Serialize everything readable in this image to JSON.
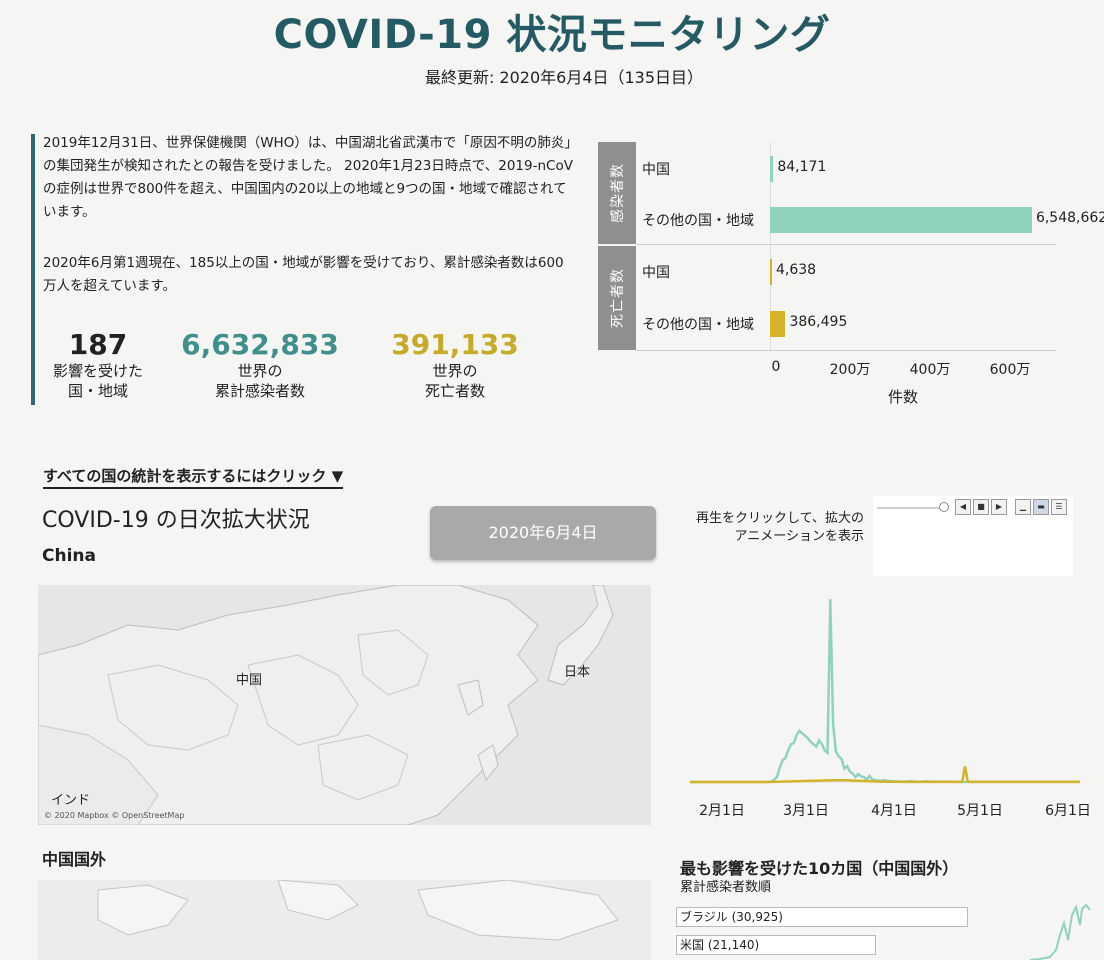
{
  "header": {
    "title": "COVID-19 状況モニタリング",
    "updated": "最終更新: 2020年6月4日（135日目）"
  },
  "intro": {
    "p1": "2019年12月31日、世界保健機関（WHO）は、中国湖北省武漢市で「原因不明の肺炎」の集団発生が検知されたとの報告を受けました。 2020年1月23日時点で、2019-nCoVの症例は世界で800件を超え、中国国内の20以上の地域と9つの国・地域で確認されています。",
    "p2": "2020年6月第1週現在、185以上の国・地域が影響を受けており、累計感染者数は600万人を超えています。"
  },
  "kpis": [
    {
      "value": "187",
      "label1": "影響を受けた",
      "label2": "国・地域",
      "color": "#222222"
    },
    {
      "value": "6,632,833",
      "label1": "世界の",
      "label2": "累計感染者数",
      "color": "#3f8f8c"
    },
    {
      "value": "391,133",
      "label1": "世界の",
      "label2": "死亡者数",
      "color": "#c7aa27"
    }
  ],
  "chart_data": [
    {
      "type": "bar",
      "orientation": "horizontal",
      "groups": [
        {
          "name": "感染者数",
          "color": "#8fd3bf",
          "rows": [
            {
              "label": "中国",
              "value": 84171,
              "value_label": "84,171"
            },
            {
              "label": "その他の国・地域",
              "value": 6548662,
              "value_label": "6,548,662"
            }
          ]
        },
        {
          "name": "死亡者数",
          "color": "#d4b32a",
          "rows": [
            {
              "label": "中国",
              "value": 4638,
              "value_label": "4,638"
            },
            {
              "label": "その他の国・地域",
              "value": 386495,
              "value_label": "386,495"
            }
          ]
        }
      ],
      "xlim": [
        0,
        7000000
      ],
      "xticks": [
        0,
        2000000,
        4000000,
        6000000
      ],
      "xtick_labels": [
        "0",
        "200万",
        "400万",
        "600万"
      ],
      "xlabel": "件数"
    },
    {
      "type": "line",
      "x_ticks": [
        "2月1日",
        "3月1日",
        "4月1日",
        "5月1日",
        "6月1日"
      ],
      "series": [
        {
          "color": "#8fd3bf",
          "values": [
            0,
            0,
            0,
            0,
            0,
            0,
            0,
            0,
            0,
            0,
            0,
            0,
            0,
            0,
            0,
            0,
            0,
            0,
            0,
            0,
            0,
            0,
            0,
            0,
            0,
            0,
            0,
            0,
            0,
            50,
            180,
            420,
            1200,
            1800,
            1950,
            2600,
            3100,
            3200,
            3850,
            4200,
            4000,
            3800,
            3600,
            3300,
            3100,
            2900,
            3400,
            3100,
            2600,
            2400,
            15000,
            4800,
            2500,
            2100,
            1900,
            1100,
            1300,
            850,
            700,
            400,
            650,
            450,
            400,
            200,
            500,
            200,
            150,
            120,
            100,
            150,
            100,
            80,
            60,
            40,
            50,
            30,
            30,
            40,
            60,
            80,
            40,
            30,
            30,
            40,
            60,
            40,
            30,
            30,
            20,
            20,
            30,
            30,
            20,
            20,
            20,
            20,
            20,
            10,
            10,
            10,
            10,
            10,
            10,
            10,
            10,
            10,
            10,
            10,
            10,
            10,
            10,
            10,
            10,
            10,
            10,
            10,
            10,
            10,
            10,
            10,
            10,
            10,
            10,
            10,
            10,
            10,
            10,
            10,
            10,
            10,
            10,
            10,
            10,
            10,
            10,
            10,
            10,
            10,
            10,
            10
          ]
        },
        {
          "color": "#d4b32a",
          "values": [
            0,
            0,
            0,
            0,
            0,
            0,
            0,
            0,
            0,
            0,
            0,
            0,
            0,
            0,
            0,
            0,
            0,
            0,
            0,
            0,
            0,
            0,
            0,
            0,
            0,
            0,
            0,
            0,
            0,
            10,
            15,
            20,
            25,
            30,
            40,
            45,
            50,
            55,
            65,
            70,
            75,
            85,
            90,
            95,
            100,
            105,
            110,
            120,
            125,
            130,
            135,
            140,
            145,
            150,
            150,
            150,
            140,
            130,
            120,
            110,
            100,
            90,
            80,
            70,
            60,
            50,
            40,
            40,
            30,
            30,
            30,
            25,
            20,
            20,
            15,
            15,
            10,
            10,
            10,
            10,
            10,
            10,
            10,
            10,
            10,
            10,
            10,
            10,
            10,
            10,
            10,
            10,
            10,
            10,
            10,
            10,
            10,
            10,
            1290,
            10,
            10,
            10,
            10,
            10,
            10,
            10,
            10,
            10,
            10,
            10,
            10,
            10,
            10,
            10,
            10,
            10,
            10,
            10,
            10,
            10,
            10,
            10,
            10,
            10,
            10,
            10,
            10,
            10,
            10,
            10,
            10,
            10,
            10,
            10,
            10,
            10,
            10,
            10,
            10,
            10
          ]
        }
      ]
    }
  ],
  "daily": {
    "link": "すべての国の統計を表示するにはクリック ▼",
    "title": "COVID-19 の日次拡大状況",
    "country": "China",
    "date": "2020年6月4日",
    "play_hint": "再生をクリックして、拡大のアニメーションを表示"
  },
  "map": {
    "labels": {
      "china": "中国",
      "japan": "日本",
      "india": "インド"
    },
    "credit": "© 2020 Mapbox © OpenStreetMap"
  },
  "outside": {
    "title": "中国国外",
    "top10_title": "最も影響を受けた10カ国（中国国外）",
    "top10_sub": "累計感染者数順",
    "rows": [
      {
        "label": "ブラジル (30,925)"
      },
      {
        "label": "米国 (21,140)"
      }
    ]
  }
}
